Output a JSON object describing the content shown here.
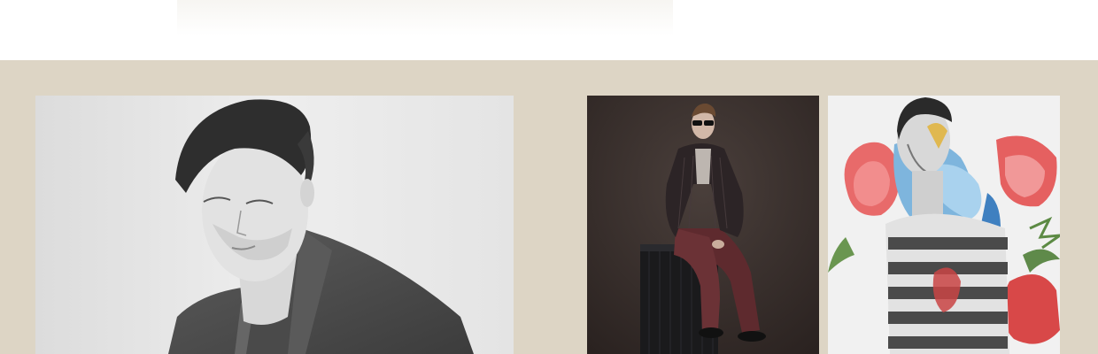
{
  "colors": {
    "page_background": "#ffffff",
    "section_background": "#ddd5c5",
    "photo1_backdrop": "#e8e8e8",
    "photo2_backdrop": "#3a302d",
    "photo3_backdrop": "#f1f1f1"
  },
  "gallery": {
    "images": [
      {
        "name": "photo-model-wool-coat",
        "style": "black-and-white portrait, man in tweed coat"
      },
      {
        "name": "photo-model-leather-jacket",
        "style": "studio shot, man in sunglasses sitting on trunk"
      },
      {
        "name": "photo-collage-floral-portrait",
        "style": "collage, face with blue/red flowers and striped shirt"
      }
    ]
  }
}
